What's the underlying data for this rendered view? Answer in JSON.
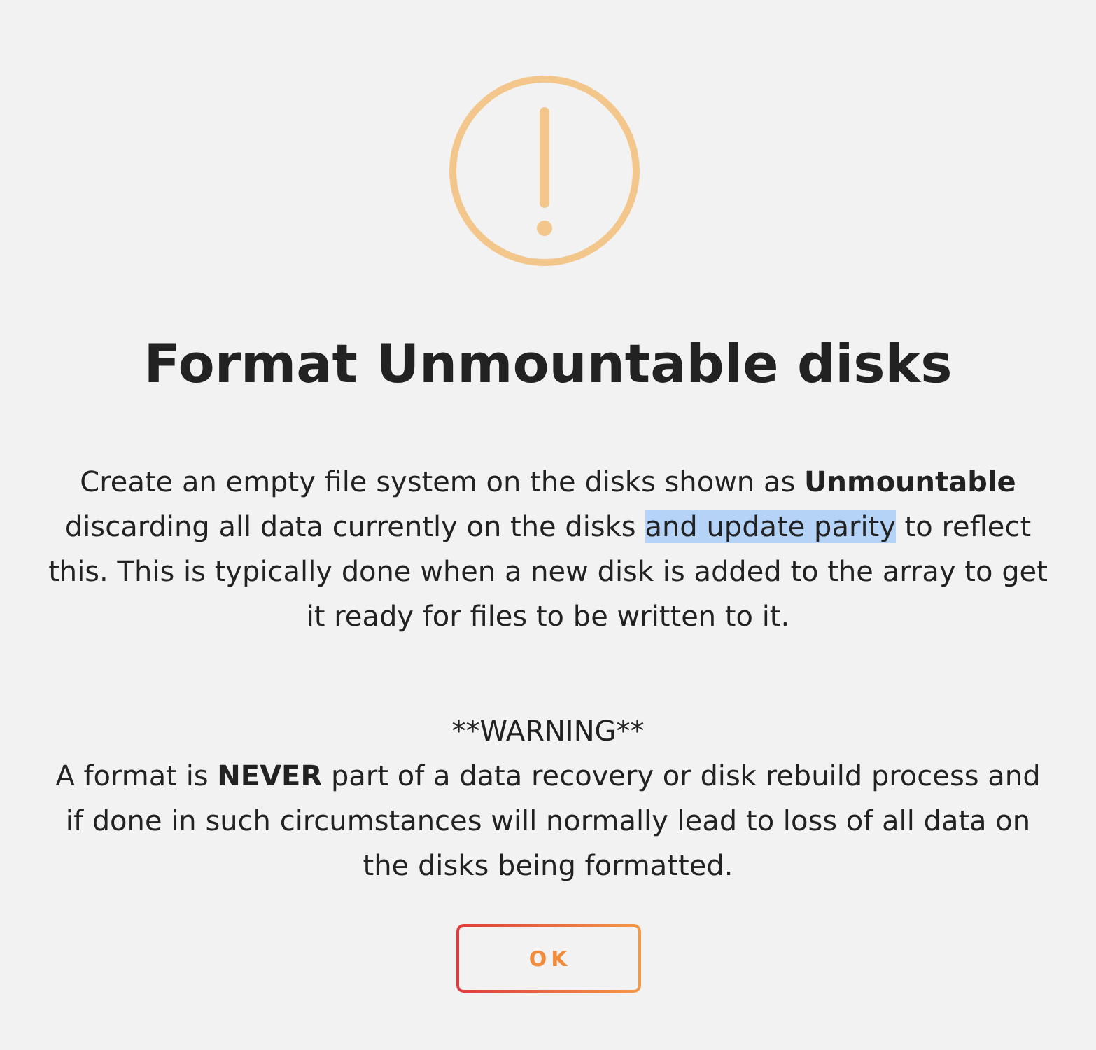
{
  "dialog": {
    "title": "Format Unmountable disks",
    "description": [
      {
        "text": "Create an empty file system on the disks shown as **Unmountable** discarding all data currently on the disks ",
        "highlighted": false
      },
      {
        "text": "and update parity",
        "highlighted": true
      },
      {
        "text": " to reflect this. This is typically done when a new disk is added to the array to get it ready for files to be written to it.",
        "highlighted": false
      }
    ],
    "warning_heading": "**WARNING**",
    "warning_text": "A format is **NEVER** part of a data recovery or disk rebuild process and if done in such circumstances will normally lead to loss of all data on the disks being formatted.",
    "buttons": [
      {
        "label": "OK"
      }
    ]
  }
}
